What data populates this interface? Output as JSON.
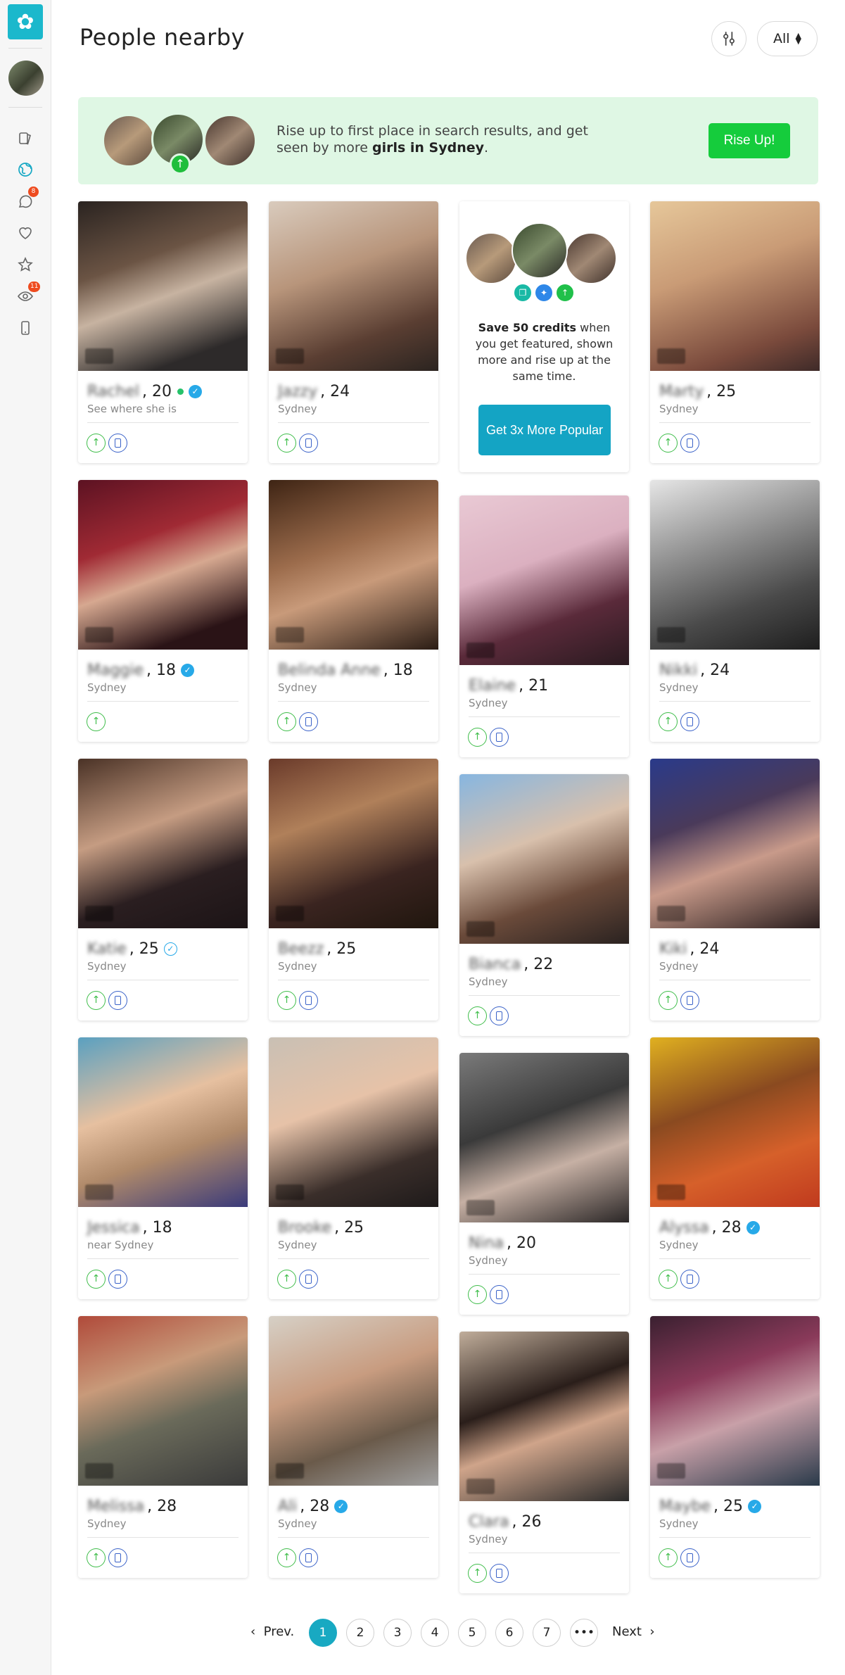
{
  "page": {
    "title": "People nearby"
  },
  "sidebar": {
    "notifications": {
      "messages_count": "8",
      "visitors_count": "11"
    },
    "icons": [
      "logo-icon",
      "cards-icon",
      "globe-icon",
      "chat-icon",
      "heart-icon",
      "star-icon",
      "eye-icon",
      "phone-icon"
    ]
  },
  "header": {
    "filter_value": "All"
  },
  "promo": {
    "text_prefix": "Rise up to first place in search results, and get seen by more ",
    "text_highlight": "girls in Sydney",
    "text_suffix": ".",
    "button_label": "Rise Up!"
  },
  "feature": {
    "bold_text": "Save 50 credits",
    "text": " when you get featured, shown more and rise up at the same time.",
    "button_label": "Get 3x More Popular"
  },
  "people": [
    {
      "name": "Rachel",
      "age": ", 20",
      "location": "See where she is",
      "online": true,
      "verified": "solid",
      "icons": [
        "up",
        "phone"
      ]
    },
    {
      "name": "Jazzy",
      "age": ", 24",
      "location": "Sydney",
      "online": false,
      "verified": "none",
      "icons": [
        "up",
        "phone"
      ]
    },
    {
      "name": "Marty",
      "age": ", 25",
      "location": "Sydney",
      "online": false,
      "verified": "none",
      "icons": [
        "up",
        "phone"
      ]
    },
    {
      "name": "Maggie",
      "age": ", 18",
      "location": "Sydney",
      "online": false,
      "verified": "solid",
      "icons": [
        "up"
      ]
    },
    {
      "name": "Belinda Anne",
      "age": ", 18",
      "location": "Sydney",
      "online": false,
      "verified": "none",
      "icons": [
        "up",
        "phone"
      ]
    },
    {
      "name": "Elaine",
      "age": ", 21",
      "location": "Sydney",
      "online": false,
      "verified": "none",
      "icons": [
        "up",
        "phone"
      ]
    },
    {
      "name": "Nikki",
      "age": ", 24",
      "location": "Sydney",
      "online": false,
      "verified": "none",
      "icons": [
        "up",
        "phone"
      ]
    },
    {
      "name": "Katie",
      "age": ", 25",
      "location": "Sydney",
      "online": false,
      "verified": "outline",
      "icons": [
        "up",
        "phone"
      ]
    },
    {
      "name": "Beezz",
      "age": ", 25",
      "location": "Sydney",
      "online": false,
      "verified": "none",
      "icons": [
        "up",
        "phone"
      ]
    },
    {
      "name": "Bianca",
      "age": ", 22",
      "location": "Sydney",
      "online": false,
      "verified": "none",
      "icons": [
        "up",
        "phone"
      ]
    },
    {
      "name": "Kiki",
      "age": ", 24",
      "location": "Sydney",
      "online": false,
      "verified": "none",
      "icons": [
        "up",
        "phone"
      ]
    },
    {
      "name": "Jessica",
      "age": ", 18",
      "location": "near Sydney",
      "online": false,
      "verified": "none",
      "icons": [
        "up",
        "phone"
      ]
    },
    {
      "name": "Brooke",
      "age": ", 25",
      "location": "Sydney",
      "online": false,
      "verified": "none",
      "icons": [
        "up",
        "phone"
      ]
    },
    {
      "name": "Nina",
      "age": ", 20",
      "location": "Sydney",
      "online": false,
      "verified": "none",
      "icons": [
        "up",
        "phone"
      ]
    },
    {
      "name": "Alyssa",
      "age": ", 28",
      "location": "Sydney",
      "online": false,
      "verified": "solid",
      "icons": [
        "up",
        "phone"
      ]
    },
    {
      "name": "Melissa",
      "age": ", 28",
      "location": "Sydney",
      "online": false,
      "verified": "none",
      "icons": [
        "up",
        "phone"
      ]
    },
    {
      "name": "Ali",
      "age": ", 28",
      "location": "Sydney",
      "online": false,
      "verified": "solid",
      "icons": [
        "up",
        "phone"
      ]
    },
    {
      "name": "Clara",
      "age": ", 26",
      "location": "Sydney",
      "online": false,
      "verified": "none",
      "icons": [
        "up",
        "phone"
      ]
    },
    {
      "name": "Maybe",
      "age": ", 25",
      "location": "Sydney",
      "online": false,
      "verified": "solid",
      "icons": [
        "up",
        "phone"
      ]
    }
  ],
  "pagination": {
    "prev_label": "Prev.",
    "next_label": "Next",
    "pages": [
      "1",
      "2",
      "3",
      "4",
      "5",
      "6",
      "7",
      "•••"
    ],
    "current": "1"
  }
}
